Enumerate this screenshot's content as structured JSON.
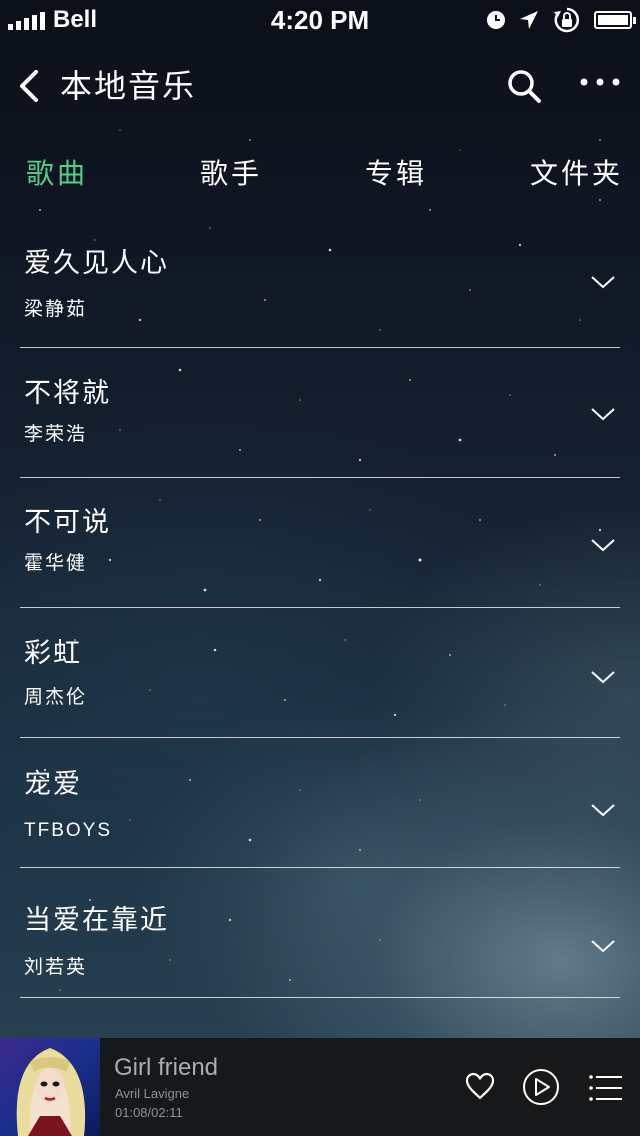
{
  "status_bar": {
    "carrier": "Bell",
    "time": "4:20 PM"
  },
  "nav": {
    "title": "本地音乐"
  },
  "tabs": [
    {
      "label": "歌曲",
      "active": true
    },
    {
      "label": "歌手",
      "active": false
    },
    {
      "label": "专辑",
      "active": false
    },
    {
      "label": "文件夹",
      "active": false
    }
  ],
  "songs": [
    {
      "title": "爱久见人心",
      "artist": "梁静茹"
    },
    {
      "title": "不将就",
      "artist": "李荣浩"
    },
    {
      "title": "不可说",
      "artist": "霍华健"
    },
    {
      "title": "彩虹",
      "artist": "周杰伦"
    },
    {
      "title": "宠爱",
      "artist": "TFBOYS"
    },
    {
      "title": "当爱在靠近",
      "artist": "刘若英"
    }
  ],
  "player": {
    "title": "Girl friend",
    "artist": "Avril Lavigne",
    "time": "01:08/02:11"
  },
  "colors": {
    "accent": "#4fd18b",
    "player_bg": "#17181a"
  }
}
